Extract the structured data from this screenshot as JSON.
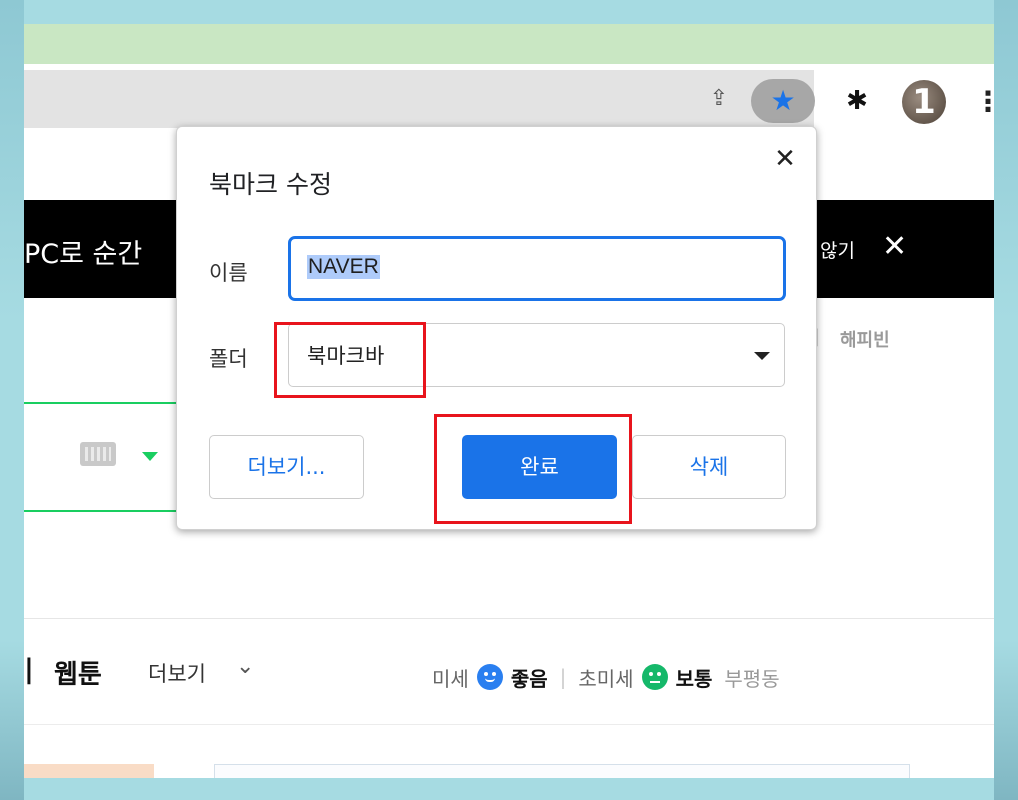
{
  "browser": {
    "icons": [
      "share-icon",
      "star-icon",
      "puzzle-icon",
      "avatar",
      "kebab-icon"
    ],
    "avatar_label": "1",
    "accent": "#1a73e8"
  },
  "page": {
    "banner_text": "PC로 순간",
    "banner_close_text": "않기",
    "happybean": "해피빈",
    "nav_webtoon": "웹툰",
    "nav_partial": "|",
    "nav_more": "더보기",
    "weather": {
      "fine_dust_label": "미세",
      "fine_dust_value": "좋음",
      "ultrafine_label": "초미세",
      "ultrafine_value": "보통",
      "location": "부평동",
      "separator": "|"
    }
  },
  "dialog": {
    "title": "북마크 수정",
    "name_label": "이름",
    "name_value": "NAVER",
    "folder_label": "폴더",
    "folder_value": "북마크바",
    "more_button": "더보기...",
    "done_button": "완료",
    "delete_button": "삭제"
  }
}
